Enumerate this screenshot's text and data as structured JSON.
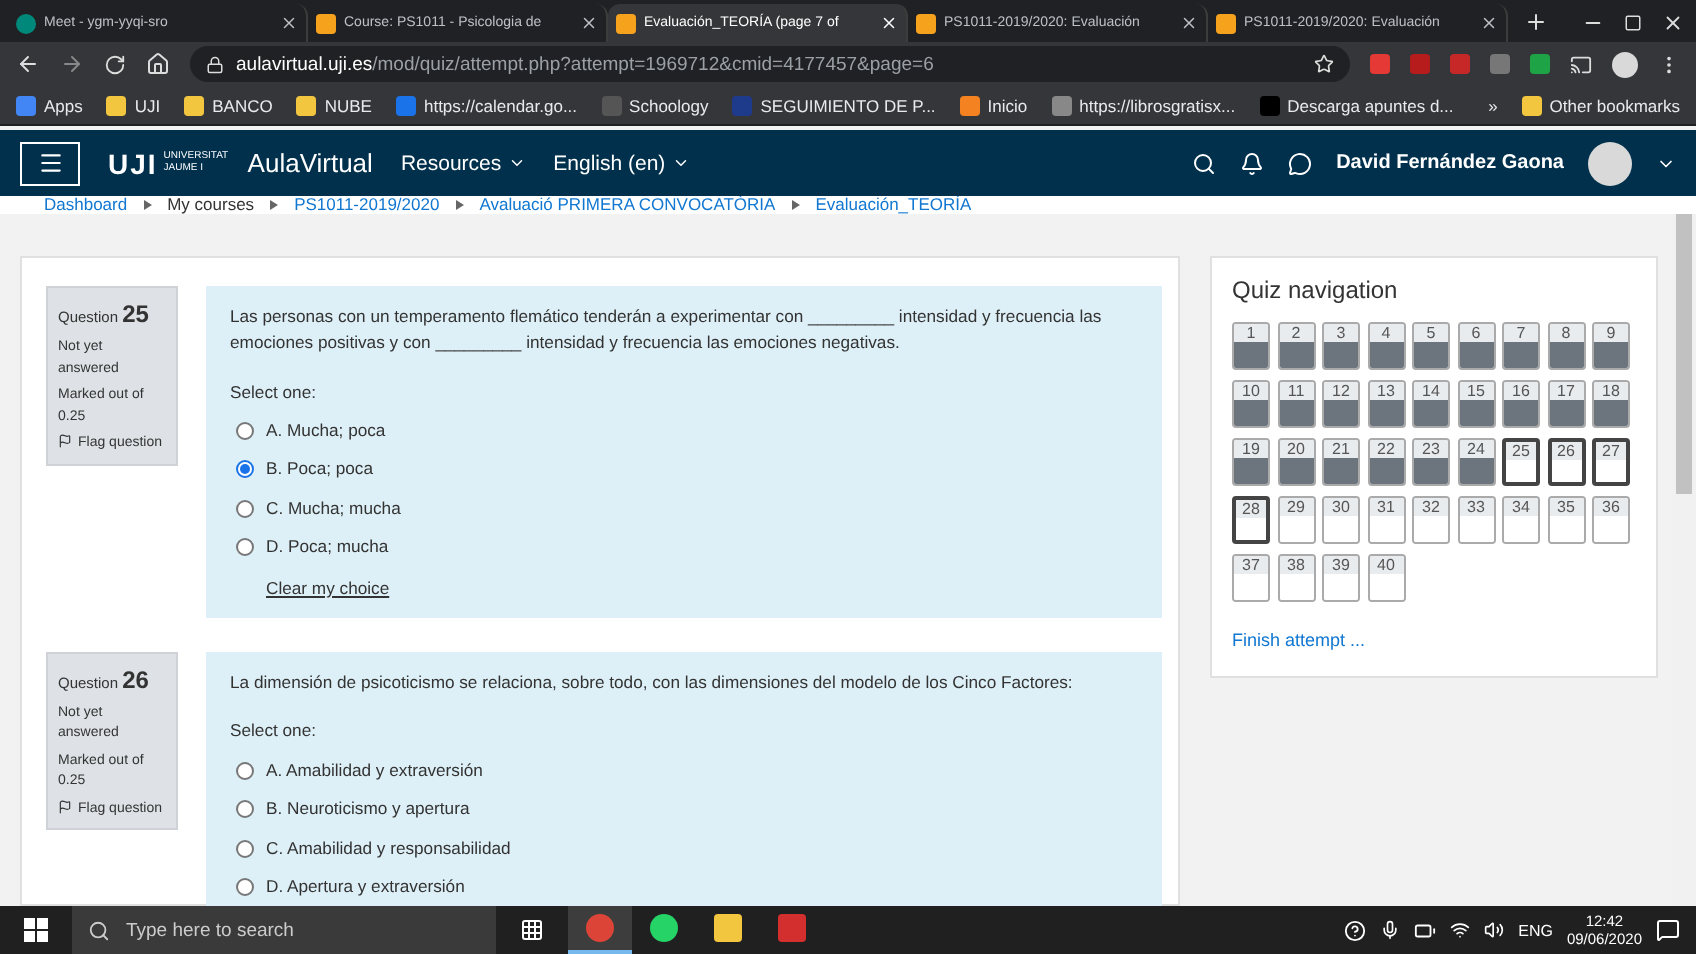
{
  "browser": {
    "tabs": [
      {
        "title": "Meet - ygm-yyqi-sro",
        "kind": "meet",
        "selected": false
      },
      {
        "title": "Course: PS1011 - Psicologia de",
        "kind": "moodle",
        "selected": false
      },
      {
        "title": "Evaluación_TEORÍA (page 7 of",
        "kind": "moodle",
        "selected": true
      },
      {
        "title": "PS1011-2019/2020: Evaluación",
        "kind": "moodle",
        "selected": false
      },
      {
        "title": "PS1011-2019/2020: Evaluación",
        "kind": "moodle",
        "selected": false
      }
    ],
    "address": {
      "host": "aulavirtual.uji.es",
      "path": "/mod/quiz/attempt.php?attempt=1969712&cmid=4177457&page=6"
    },
    "bookmarks": [
      {
        "label": "Apps",
        "kind": "apps"
      },
      {
        "label": "UJI",
        "kind": "folder"
      },
      {
        "label": "BANCO",
        "kind": "folder"
      },
      {
        "label": "NUBE",
        "kind": "folder"
      },
      {
        "label": "https://calendar.go...",
        "kind": "calendar"
      },
      {
        "label": "Schoology",
        "kind": "schoology"
      },
      {
        "label": "SEGUIMIENTO DE P...",
        "kind": "seventeen"
      },
      {
        "label": "Inicio",
        "kind": "inicio"
      },
      {
        "label": "https://librosgratisx...",
        "kind": "globe"
      },
      {
        "label": "Descarga apuntes d...",
        "kind": "wuolah"
      }
    ],
    "overflow": "»",
    "other_bookmarks": "Other bookmarks"
  },
  "site": {
    "logo": "UJI",
    "logo_sub": "UNIVERSITAT JAUME I",
    "brand": "AulaVirtual",
    "menus": [
      "Resources",
      "English (en)"
    ],
    "user": "David Fernández Gaona"
  },
  "breadcrumb": [
    "Dashboard",
    "My courses",
    "PS1011-2019/2020",
    "Avaluació PRIMERA CONVOCATÒRIA",
    "Evaluación_TEORÍA"
  ],
  "questions": [
    {
      "label": "Question",
      "number": "25",
      "status": "Not yet answered",
      "marks": "Marked out of 0.25",
      "flag": "Flag question",
      "text": "Las personas con un temperamento flemático tenderán a experimentar con _________ intensidad y frecuencia las emociones positivas y con _________ intensidad y frecuencia las emociones negativas.",
      "prompt": "Select one:",
      "options": [
        {
          "label": "A. Mucha; poca",
          "selected": false
        },
        {
          "label": "B. Poca; poca",
          "selected": true
        },
        {
          "label": "C. Mucha; mucha",
          "selected": false
        },
        {
          "label": "D. Poca; mucha",
          "selected": false
        }
      ],
      "clear": "Clear my choice"
    },
    {
      "label": "Question",
      "number": "26",
      "status": "Not yet answered",
      "marks": "Marked out of 0.25",
      "flag": "Flag question",
      "text": "La dimensión de psicoticismo se relaciona, sobre todo, con las dimensiones del modelo de los Cinco Factores:",
      "prompt": "Select one:",
      "options": [
        {
          "label": "A. Amabilidad y extraversión",
          "selected": false
        },
        {
          "label": "B. Neuroticismo y apertura",
          "selected": false
        },
        {
          "label": "C. Amabilidad y responsabilidad",
          "selected": false
        },
        {
          "label": "D. Apertura y extraversión",
          "selected": false
        }
      ]
    }
  ],
  "quiz_nav": {
    "title": "Quiz navigation",
    "items": [
      {
        "number": "1",
        "answered": true,
        "selected": false
      },
      {
        "number": "2",
        "answered": true,
        "selected": false
      },
      {
        "number": "3",
        "answered": true,
        "selected": false
      },
      {
        "number": "4",
        "answered": true,
        "selected": false
      },
      {
        "number": "5",
        "answered": true,
        "selected": false
      },
      {
        "number": "6",
        "answered": true,
        "selected": false
      },
      {
        "number": "7",
        "answered": true,
        "selected": false
      },
      {
        "number": "8",
        "answered": true,
        "selected": false
      },
      {
        "number": "9",
        "answered": true,
        "selected": false
      },
      {
        "number": "10",
        "answered": true,
        "selected": false
      },
      {
        "number": "11",
        "answered": true,
        "selected": false
      },
      {
        "number": "12",
        "answered": true,
        "selected": false
      },
      {
        "number": "13",
        "answered": true,
        "selected": false
      },
      {
        "number": "14",
        "answered": true,
        "selected": false
      },
      {
        "number": "15",
        "answered": true,
        "selected": false
      },
      {
        "number": "16",
        "answered": true,
        "selected": false
      },
      {
        "number": "17",
        "answered": true,
        "selected": false
      },
      {
        "number": "18",
        "answered": true,
        "selected": false
      },
      {
        "number": "19",
        "answered": true,
        "selected": false
      },
      {
        "number": "20",
        "answered": true,
        "selected": false
      },
      {
        "number": "21",
        "answered": true,
        "selected": false
      },
      {
        "number": "22",
        "answered": true,
        "selected": false
      },
      {
        "number": "23",
        "answered": true,
        "selected": false
      },
      {
        "number": "24",
        "answered": true,
        "selected": false
      },
      {
        "number": "25",
        "answered": false,
        "selected": true
      },
      {
        "number": "26",
        "answered": false,
        "selected": true
      },
      {
        "number": "27",
        "answered": false,
        "selected": true
      },
      {
        "number": "28",
        "answered": false,
        "selected": true
      },
      {
        "number": "29",
        "answered": false,
        "selected": false
      },
      {
        "number": "30",
        "answered": false,
        "selected": false
      },
      {
        "number": "31",
        "answered": false,
        "selected": false
      },
      {
        "number": "32",
        "answered": false,
        "selected": false
      },
      {
        "number": "33",
        "answered": false,
        "selected": false
      },
      {
        "number": "34",
        "answered": false,
        "selected": false
      },
      {
        "number": "35",
        "answered": false,
        "selected": false
      },
      {
        "number": "36",
        "answered": false,
        "selected": false
      },
      {
        "number": "37",
        "answered": false,
        "selected": false
      },
      {
        "number": "38",
        "answered": false,
        "selected": false
      },
      {
        "number": "39",
        "answered": false,
        "selected": false
      },
      {
        "number": "40",
        "answered": false,
        "selected": false
      }
    ],
    "finish": "Finish attempt ..."
  },
  "taskbar": {
    "search_placeholder": "Type here to search",
    "apps": [
      {
        "kind": "chrome",
        "selected": true
      },
      {
        "kind": "whatsapp",
        "selected": false
      },
      {
        "kind": "explorer",
        "selected": false
      },
      {
        "kind": "acrobat",
        "selected": false
      }
    ],
    "lang": "ENG",
    "time": "12:42",
    "date": "09/06/2020"
  }
}
